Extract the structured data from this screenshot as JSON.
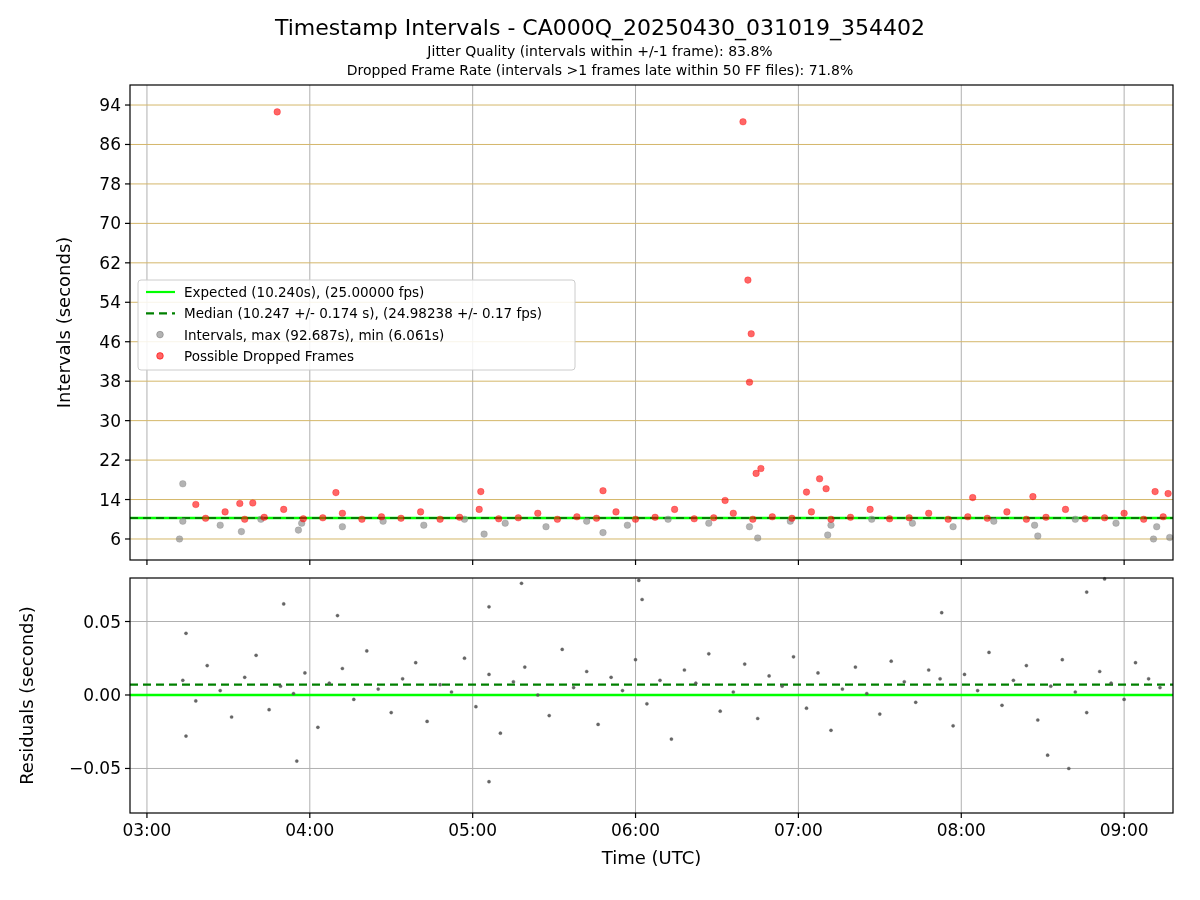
{
  "title": "Timestamp Intervals - CA000Q_20250430_031019_354402",
  "subtitles": [
    "Jitter Quality (intervals within +/-1 frame): 83.8%",
    "Dropped Frame Rate (intervals >1 frames late within 50 FF files): 71.8%"
  ],
  "charts": [
    {
      "chart_data": {
        "type": "scatter",
        "grid": true,
        "legend": "center left",
        "ylabel": "Intervals (seconds)",
        "xlim": [
          2.896,
          9.3
        ],
        "ylim": [
          1.74,
          98.06
        ],
        "yticks": [
          {
            "value": 6,
            "label": "6"
          },
          {
            "value": 14,
            "label": "14"
          },
          {
            "value": 22,
            "label": "22"
          },
          {
            "value": 30,
            "label": "30"
          },
          {
            "value": 38,
            "label": "38"
          },
          {
            "value": 46,
            "label": "46"
          },
          {
            "value": 54,
            "label": "54"
          },
          {
            "value": 62,
            "label": "62"
          },
          {
            "value": 70,
            "label": "70"
          },
          {
            "value": 78,
            "label": "78"
          },
          {
            "value": 86,
            "label": "86"
          },
          {
            "value": 94,
            "label": "94"
          }
        ],
        "series": [
          {
            "name": "Expected (10.240s), (25.00000 fps)",
            "type": "line",
            "line_style": "solid",
            "color": "#00ff00",
            "x": [
              2.896,
              9.3
            ],
            "values": [
              10.24,
              10.24
            ]
          },
          {
            "name": "Median (10.247 +/- 0.174 s), (24.98238 +/- 0.17 fps)",
            "type": "line",
            "line_style": "dashed",
            "color": "#008000",
            "x": [
              2.896,
              9.3
            ],
            "values": [
              10.247,
              10.247
            ]
          },
          {
            "name": "Intervals, max (92.687s), min (6.061s)",
            "type": "scatter",
            "color": "#808080",
            "x": [
              3.22,
              3.45,
              3.7,
              3.95,
              4.2,
              4.45,
              4.7,
              4.95,
              5.2,
              5.45,
              5.7,
              5.95,
              6.2,
              6.45,
              6.7,
              6.95,
              7.2,
              7.45,
              7.7,
              7.95,
              8.2,
              8.45,
              8.7,
              8.95,
              9.2,
              3.22,
              3.2,
              3.58,
              3.93,
              5.07,
              5.8,
              6.75,
              7.18,
              8.47,
              9.18,
              9.28
            ],
            "values": [
              9.6,
              8.8,
              10.0,
              9.2,
              8.5,
              9.6,
              8.8,
              10.0,
              9.2,
              8.5,
              9.6,
              8.8,
              10.0,
              9.2,
              8.5,
              9.6,
              8.8,
              10.0,
              9.2,
              8.5,
              9.6,
              8.8,
              10.0,
              9.2,
              8.5,
              17.2,
              6.0,
              7.5,
              7.8,
              7.0,
              7.3,
              6.2,
              6.8,
              6.6,
              6.0,
              6.3
            ]
          },
          {
            "name": "Possible Dropped Frames",
            "type": "scatter",
            "color": "#ff0000",
            "x": [
              3.36,
              3.48,
              3.6,
              3.72,
              3.84,
              3.96,
              4.08,
              4.2,
              4.32,
              4.44,
              4.56,
              4.68,
              4.8,
              4.92,
              5.04,
              5.16,
              5.28,
              5.4,
              5.52,
              5.64,
              5.76,
              5.88,
              6.0,
              6.12,
              6.24,
              6.36,
              6.48,
              6.6,
              6.72,
              6.84,
              6.96,
              7.08,
              7.2,
              7.32,
              7.44,
              7.56,
              7.68,
              7.8,
              7.92,
              8.04,
              8.16,
              8.28,
              8.4,
              8.52,
              8.64,
              8.76,
              8.88,
              9.0,
              9.12,
              9.24,
              3.8,
              6.66,
              6.69,
              6.71,
              6.7,
              6.74,
              6.77,
              7.13,
              7.17,
              3.3,
              3.57,
              3.65,
              4.16,
              5.05,
              5.8,
              7.05,
              8.07,
              8.44,
              9.19,
              9.27,
              6.55
            ],
            "values": [
              10.2,
              11.5,
              10.0,
              10.4,
              12.0,
              10.1,
              10.3,
              11.2,
              10.0,
              10.5,
              10.2,
              11.5,
              10.0,
              10.4,
              12.0,
              10.1,
              10.3,
              11.2,
              10.0,
              10.5,
              10.2,
              11.5,
              10.0,
              10.4,
              12.0,
              10.1,
              10.3,
              11.2,
              10.0,
              10.5,
              10.2,
              11.5,
              10.0,
              10.4,
              12.0,
              10.1,
              10.3,
              11.2,
              10.0,
              10.5,
              10.2,
              11.5,
              10.0,
              10.4,
              12.0,
              10.1,
              10.3,
              11.2,
              10.0,
              10.5,
              92.6,
              90.6,
              58.5,
              47.6,
              37.8,
              19.3,
              20.3,
              18.2,
              16.2,
              13.0,
              13.2,
              13.3,
              15.4,
              15.6,
              15.8,
              15.5,
              14.4,
              14.6,
              15.6,
              15.2,
              13.8
            ]
          }
        ]
      }
    },
    {
      "chart_data": {
        "type": "scatter",
        "grid": true,
        "xlabel": "Time (UTC)",
        "ylabel": "Residuals (seconds)",
        "xlim": [
          2.896,
          9.3
        ],
        "ylim": [
          -0.0803,
          0.0796
        ],
        "xticks": [
          {
            "value": 3,
            "label": "03:00"
          },
          {
            "value": 4,
            "label": "04:00"
          },
          {
            "value": 5,
            "label": "05:00"
          },
          {
            "value": 6,
            "label": "06:00"
          },
          {
            "value": 7,
            "label": "07:00"
          },
          {
            "value": 8,
            "label": "08:00"
          },
          {
            "value": 9,
            "label": "09:00"
          }
        ],
        "yticks": [
          {
            "value": -0.05,
            "label": "−0.05"
          },
          {
            "value": 0,
            "label": "0.00"
          },
          {
            "value": 0.05,
            "label": "0.05"
          }
        ],
        "series": [
          {
            "type": "line",
            "line_style": "solid",
            "color": "#00ff00",
            "x": [
              2.896,
              9.3
            ],
            "values": [
              0,
              0
            ]
          },
          {
            "type": "line",
            "line_style": "dashed",
            "color": "#008000",
            "x": [
              2.896,
              9.3
            ],
            "values": [
              0.007,
              0.007
            ]
          },
          {
            "type": "scatter",
            "color": "#555555",
            "x": [
              3.22,
              3.3,
              3.37,
              3.45,
              3.52,
              3.6,
              3.67,
              3.75,
              3.82,
              3.9,
              3.97,
              4.05,
              4.12,
              4.2,
              4.27,
              4.35,
              4.42,
              4.5,
              4.57,
              4.65,
              4.72,
              4.8,
              4.87,
              4.95,
              5.02,
              5.1,
              5.17,
              5.25,
              5.32,
              5.4,
              5.47,
              5.55,
              5.62,
              5.7,
              5.77,
              5.85,
              5.92,
              6.0,
              6.07,
              6.15,
              6.22,
              6.3,
              6.37,
              6.45,
              6.52,
              6.6,
              6.67,
              6.75,
              6.82,
              6.9,
              6.97,
              7.05,
              7.12,
              7.2,
              7.27,
              7.35,
              7.42,
              7.5,
              7.57,
              7.65,
              7.72,
              7.8,
              7.87,
              7.95,
              8.02,
              8.1,
              8.17,
              8.25,
              8.32,
              8.4,
              8.47,
              8.55,
              8.62,
              8.7,
              8.77,
              8.85,
              8.92,
              9.0,
              9.07,
              9.15,
              9.22,
              3.84,
              3.92,
              4.17,
              5.1,
              5.1,
              5.3,
              6.02,
              6.04,
              7.88,
              8.53,
              8.66,
              8.77,
              8.88,
              3.24,
              3.24
            ],
            "values": [
              0.01,
              -0.004,
              0.02,
              0.003,
              -0.015,
              0.012,
              0.027,
              -0.01,
              0.006,
              0.001,
              0.015,
              -0.022,
              0.008,
              0.018,
              -0.003,
              0.03,
              0.004,
              -0.012,
              0.011,
              0.022,
              -0.018,
              0.007,
              0.002,
              0.025,
              -0.008,
              0.014,
              -0.026,
              0.009,
              0.019,
              0.0,
              -0.014,
              0.031,
              0.005,
              0.016,
              -0.02,
              0.012,
              0.003,
              0.024,
              -0.006,
              0.01,
              -0.03,
              0.017,
              0.008,
              0.028,
              -0.011,
              0.002,
              0.021,
              -0.016,
              0.013,
              0.006,
              0.026,
              -0.009,
              0.015,
              -0.024,
              0.004,
              0.019,
              0.001,
              -0.013,
              0.023,
              0.009,
              -0.005,
              0.017,
              0.011,
              -0.021,
              0.014,
              0.003,
              0.029,
              -0.007,
              0.01,
              0.02,
              -0.017,
              0.006,
              0.024,
              0.002,
              -0.012,
              0.016,
              0.008,
              -0.003,
              0.022,
              0.011,
              0.005,
              0.062,
              -0.045,
              0.054,
              0.06,
              -0.059,
              0.076,
              0.078,
              0.065,
              0.056,
              -0.041,
              -0.05,
              0.07,
              0.079,
              -0.028,
              0.042
            ]
          }
        ]
      }
    }
  ]
}
